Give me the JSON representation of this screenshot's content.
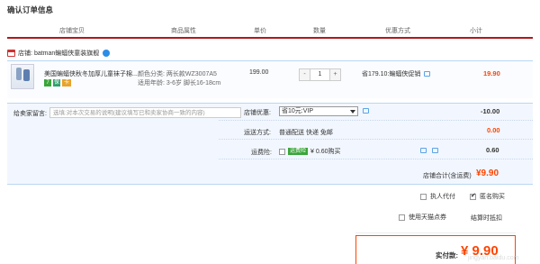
{
  "page_title": "确认订单信息",
  "columns": [
    "店铺宝贝",
    "商品属性",
    "单价",
    "数量",
    "优惠方式",
    "小计"
  ],
  "shop": {
    "label": "店铺:",
    "name": "batman蝙蝠侠童装旗舰"
  },
  "item": {
    "name": "美国蝙蝠侠秋冬加厚儿童袜子棉...",
    "tags": [
      "7",
      "保",
      "卡"
    ],
    "prop_color_label": "颜色分类:",
    "prop_color": "两长款WZ3007A5",
    "prop_age_label": "适用年龄:",
    "prop_age": "3-6岁 脚长16-18cm",
    "price": "199.00",
    "qty": {
      "minus": "-",
      "value": "1",
      "plus": "+"
    },
    "discount": "省179.10:蝙蝠侠促销",
    "subtotal": "19.90"
  },
  "message": {
    "label": "给卖家留言:",
    "placeholder": "选填:对本次交易的说明(建议填写已和卖家协商一致的内容)"
  },
  "shop_discount": {
    "label": "店铺优惠:",
    "value": "省10元:VIP",
    "amount": "-10.00"
  },
  "shipping": {
    "label": "运送方式:",
    "value": "普通配送 快递 免邮",
    "amount": "0.00"
  },
  "insurance": {
    "label": "运费险:",
    "tag": "运费险",
    "value": "¥ 0.60购买",
    "amount": "0.60"
  },
  "shop_total": {
    "label": "店铺合计(含运费)",
    "amount": "¥9.90"
  },
  "options": {
    "anonymous": "执人代付",
    "anonymous_buy": "匿名购买",
    "tmall_coupon": "使用天猫点券",
    "settle": "结算时抵扣"
  },
  "pay": {
    "label": "实付款:",
    "amount": "¥ 9.90"
  },
  "watermark": "jingyan.baidu.com",
  "colors": {
    "accent": "#b1191a",
    "price_red": "#ff4400",
    "link_blue": "#2b8de6"
  }
}
